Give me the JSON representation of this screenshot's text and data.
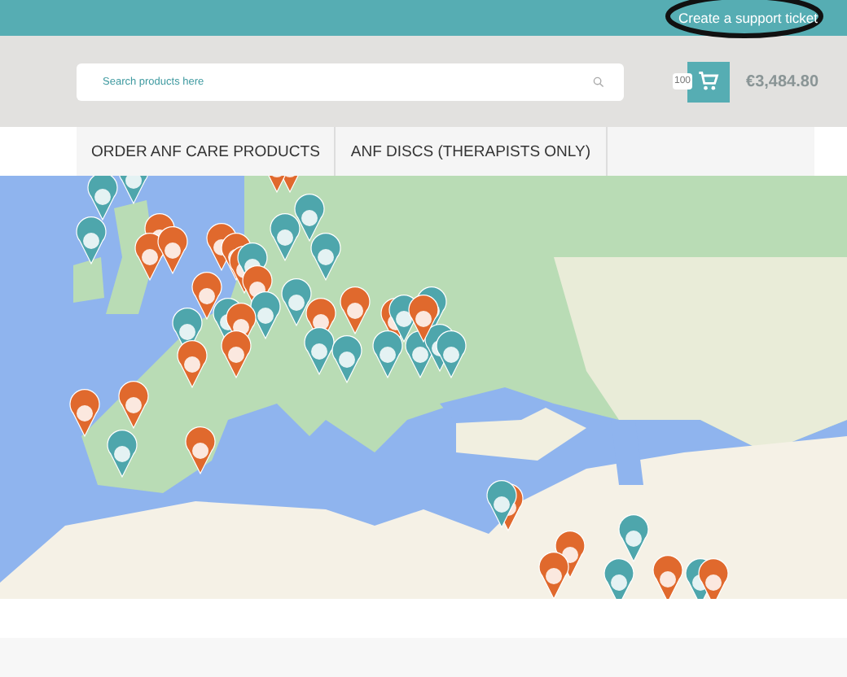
{
  "top_bar": {
    "link": "Create a support ticket"
  },
  "search": {
    "placeholder": "Search products here"
  },
  "cart": {
    "count": "100",
    "total": "€3,484.80"
  },
  "nav": {
    "tabs": [
      {
        "label": "ORDER ANF CARE PRODUCTS",
        "selected": false
      },
      {
        "label": "ANF DISCS (THERAPISTS ONLY)",
        "selected": false
      }
    ]
  }
}
